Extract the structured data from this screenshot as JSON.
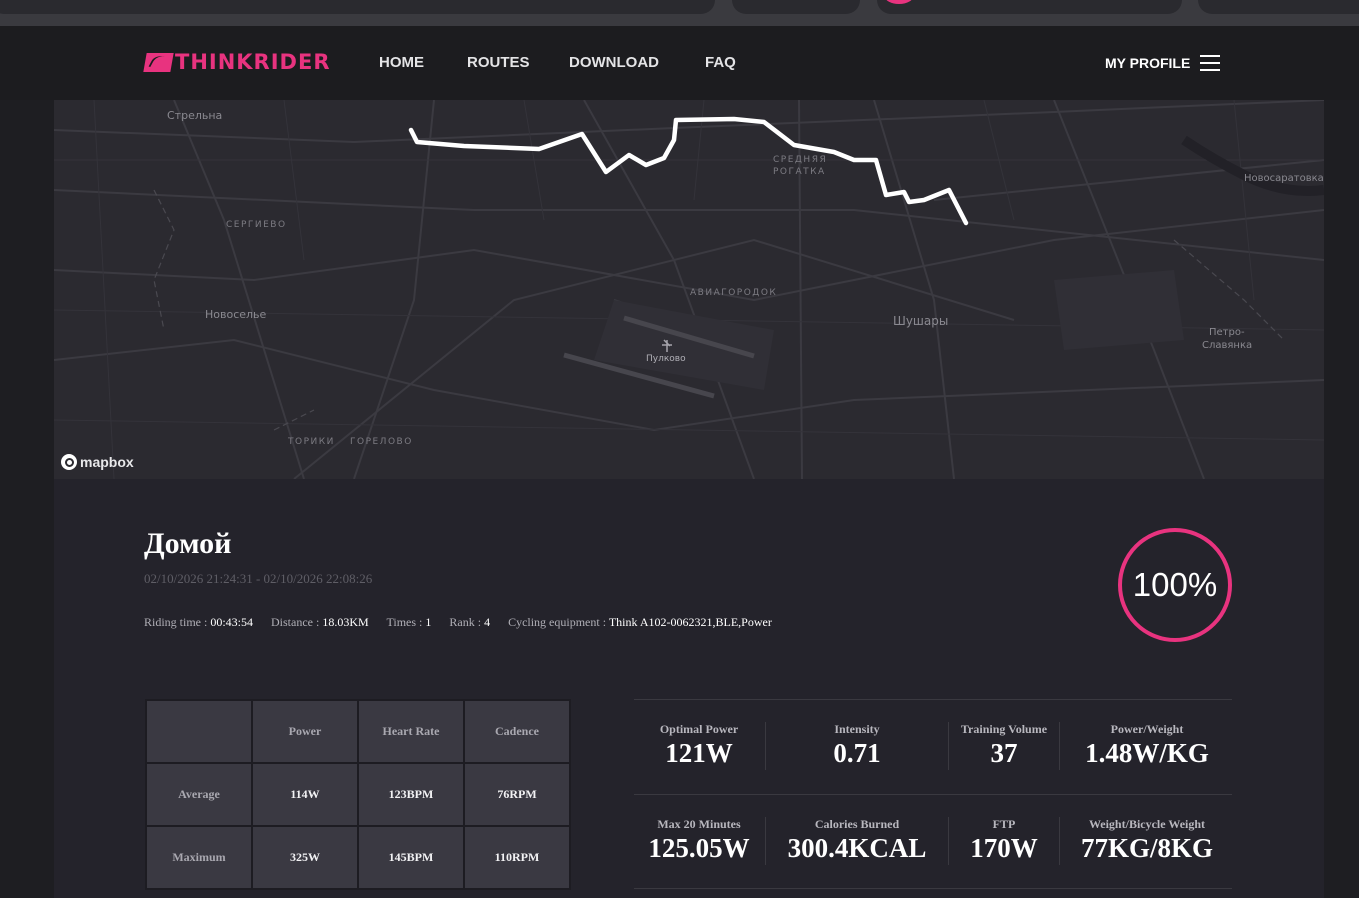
{
  "nav": {
    "logo_text": "THINKRIDER",
    "links": [
      "HOME",
      "ROUTES",
      "DOWNLOAD",
      "FAQ"
    ],
    "profile_label": "MY PROFILE"
  },
  "map": {
    "labels": [
      "Стрельна",
      "СЕРГИЕВО",
      "Новоселье",
      "ТОРИКИ",
      "ГОРЕЛОВО",
      "СРЕДНЯЯ",
      "РОГАТКА",
      "АВИАГОРОДОК",
      "Пулково",
      "Шушары",
      "Новосаратовка",
      "Петро-",
      "Славянка"
    ],
    "attribution": "mapbox",
    "route_color": "#ffffff"
  },
  "ride": {
    "title": "Домой",
    "date_range": "02/10/2026 21:24:31 - 02/10/2026 22:08:26",
    "riding_time_label": "Riding time : ",
    "riding_time": "00:43:54",
    "distance_label": "Distance : ",
    "distance": "18.03KM",
    "times_label": "Times : ",
    "times": "1",
    "rank_label": "Rank : ",
    "rank": "4",
    "equipment_label": "Cycling equipment : ",
    "equipment": "Think A102-0062321,BLE,Power",
    "completion": "100%",
    "completion_fraction": 1.0
  },
  "stats_table": {
    "headers": [
      "",
      "Power",
      "Heart Rate",
      "Cadence"
    ],
    "rows": [
      {
        "label": "Average",
        "values": [
          "114W",
          "123BPM",
          "76RPM"
        ]
      },
      {
        "label": "Maximum",
        "values": [
          "325W",
          "145BPM",
          "110RPM"
        ]
      }
    ]
  },
  "metrics": {
    "row1": [
      {
        "label": "Optimal Power",
        "value": "121W"
      },
      {
        "label": "Intensity",
        "value": "0.71"
      },
      {
        "label": "Training Volume",
        "value": "37"
      },
      {
        "label": "Power/Weight",
        "value": "1.48W/KG"
      }
    ],
    "row2": [
      {
        "label": "Max 20 Minutes",
        "value": "125.05W"
      },
      {
        "label": "Calories Burned",
        "value": "300.4KCAL"
      },
      {
        "label": "FTP",
        "value": "170W"
      },
      {
        "label": "Weight/Bicycle Weight",
        "value": "77KG/8KG"
      }
    ]
  },
  "colors": {
    "accent": "#e8337f",
    "background": "#1e1e22",
    "panel": "#24232b",
    "map": "#2b2a30"
  }
}
